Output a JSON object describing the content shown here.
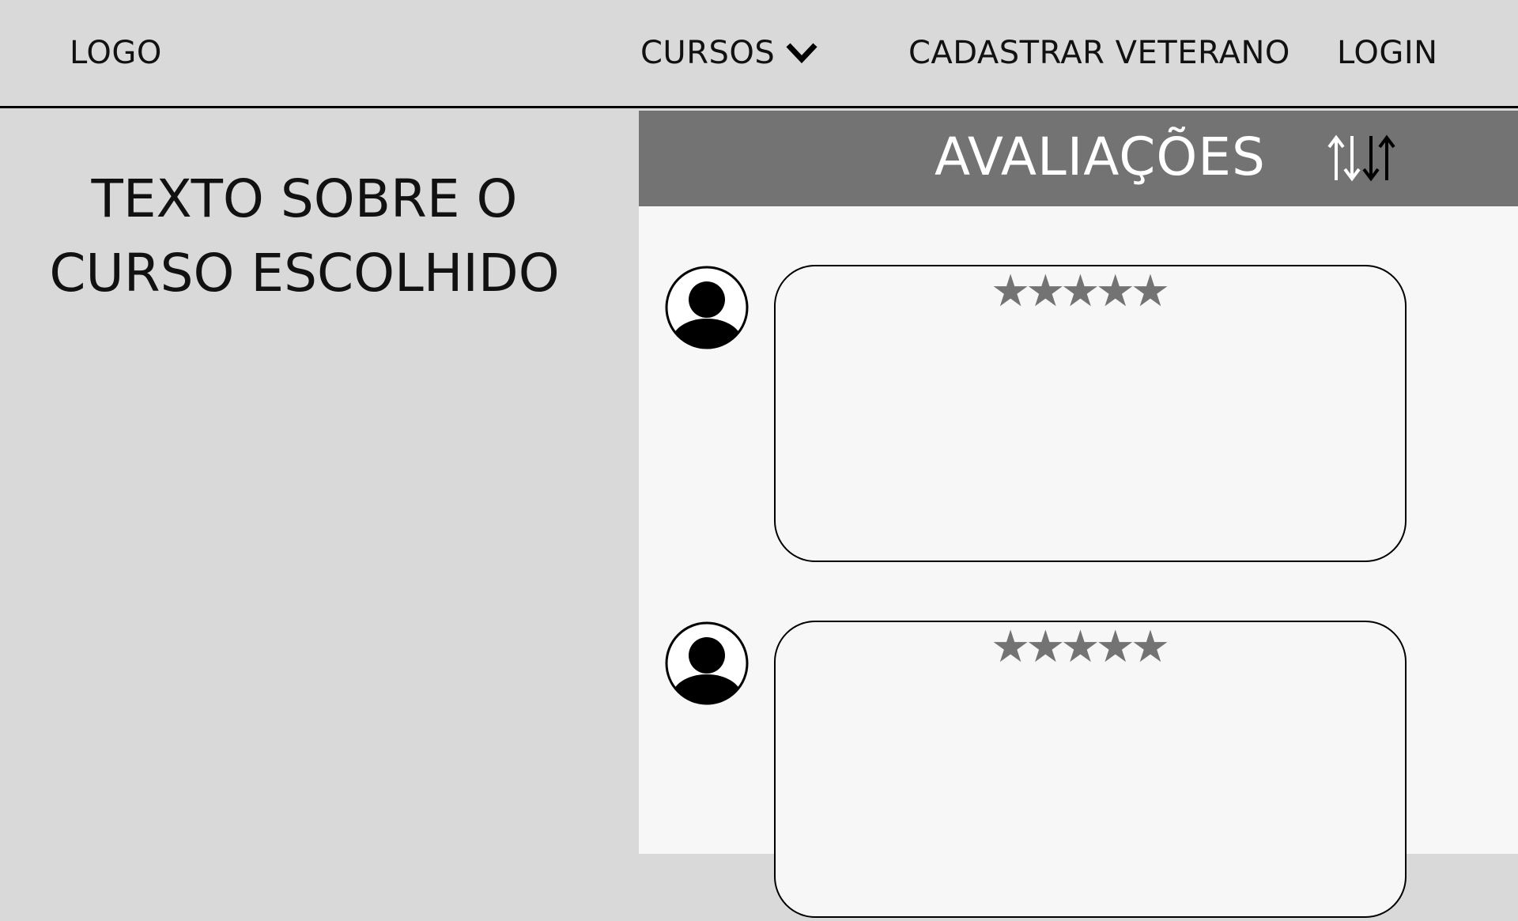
{
  "nav": {
    "logo": "LOGO",
    "courses": "CURSOS",
    "register_veteran": "CADASTRAR VETERANO",
    "login": "LOGIN"
  },
  "course": {
    "description_line1": "TEXTO SOBRE O",
    "description_line2": "CURSO ESCOLHIDO"
  },
  "reviews": {
    "title": "AVALIAÇÕES",
    "items": [
      {
        "stars": "★★★★★",
        "rating": 5,
        "text": ""
      },
      {
        "stars": "★★★★★",
        "rating": 5,
        "text": ""
      }
    ]
  },
  "colors": {
    "background": "#d9d9d9",
    "header": "#737373",
    "panel": "#f7f7f7",
    "star": "#737373"
  },
  "icons": [
    "chevron-down-icon",
    "sort-icon",
    "user-avatar-icon"
  ]
}
